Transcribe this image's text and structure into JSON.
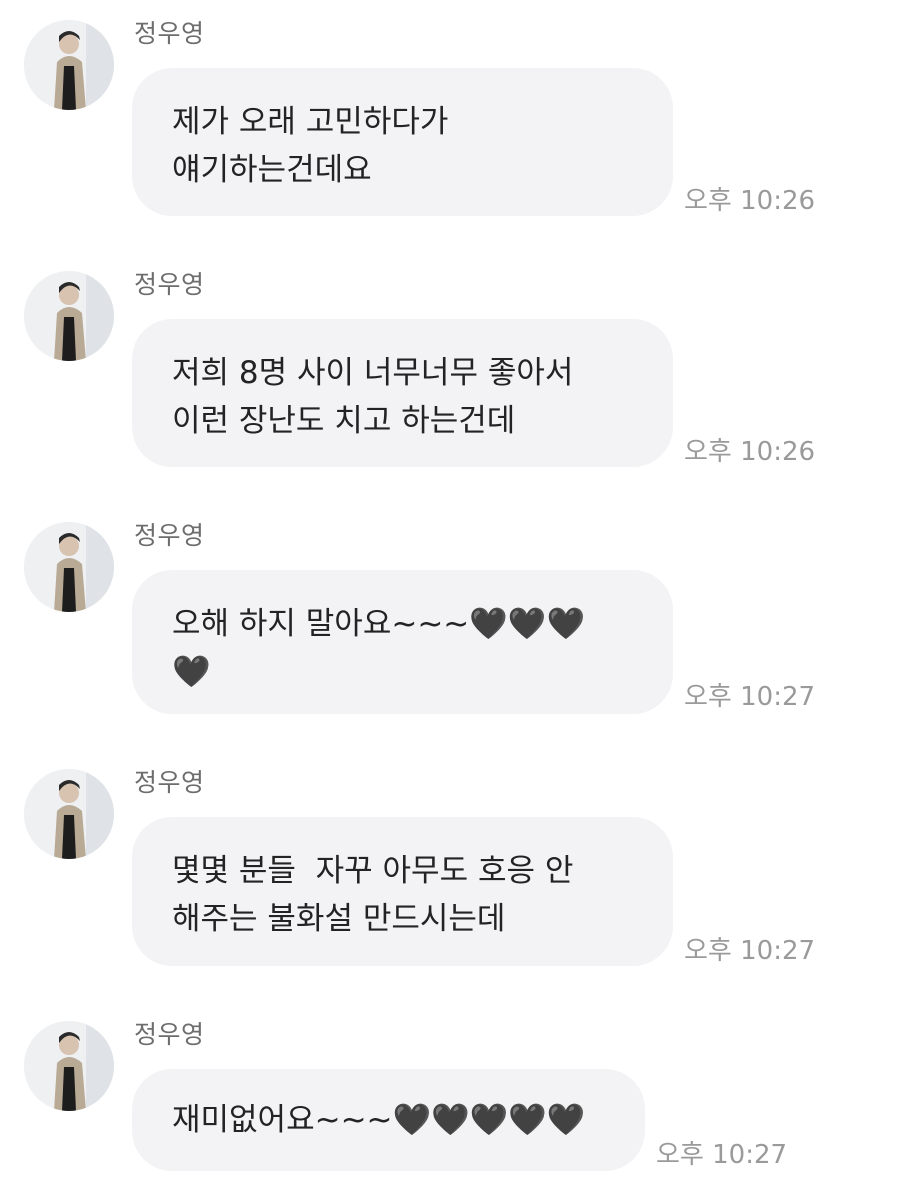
{
  "messages": [
    {
      "sender": "정우영",
      "text": "제가 오래 고민하다가\n얘기하는건데요",
      "time": "오후 10:26"
    },
    {
      "sender": "정우영",
      "text": "저희 8명 사이 너무너무 좋아서\n이런 장난도 치고 하는건데",
      "time": "오후 10:26"
    },
    {
      "sender": "정우영",
      "text": "오해 하지 말아요~~~🖤🖤🖤\n🖤",
      "time": "오후 10:27"
    },
    {
      "sender": "정우영",
      "text": "몇몇 분들  자꾸 아무도 호응 안\n해주는 불화설 만드시는데",
      "time": "오후 10:27"
    },
    {
      "sender": "정우영",
      "text": "재미없어요~~~🖤🖤🖤🖤🖤",
      "time": "오후 10:27"
    }
  ]
}
